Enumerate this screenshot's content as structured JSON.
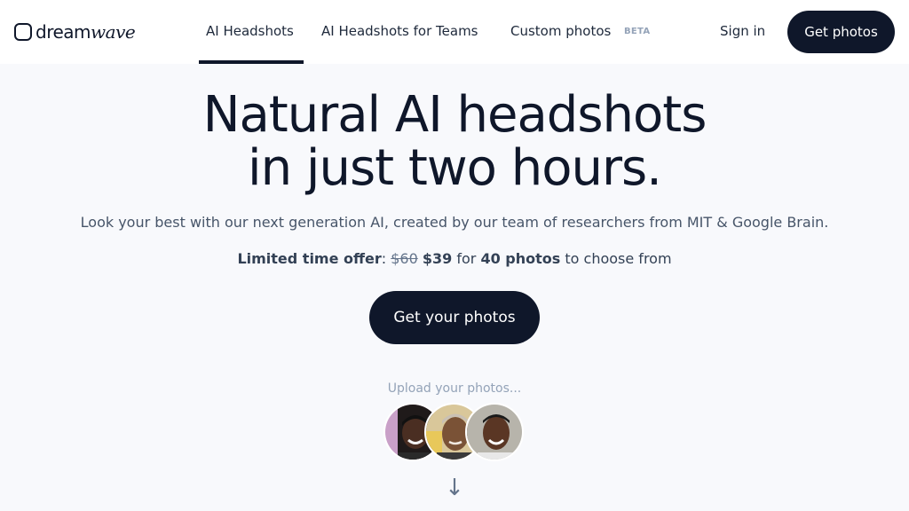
{
  "nav": {
    "logo_plain": "dream",
    "logo_italic": "wave",
    "links": [
      "AI Headshots",
      "AI Headshots for Teams",
      "Custom photos"
    ],
    "beta_badge": "BETA",
    "signin": "Sign in",
    "cta": "Get photos"
  },
  "hero": {
    "title_line1": "Natural AI headshots",
    "title_line2": "in just two hours.",
    "subtitle": "Look your best with our next generation AI, created by our team of researchers from MIT & Google Brain.",
    "offer_label": "Limited time offer",
    "offer_colon": ":",
    "old_price": "$60",
    "new_price": "$39",
    "for_text": "for",
    "photo_count": "40 photos",
    "choose_text": "to choose from",
    "cta": "Get your photos"
  },
  "upload": {
    "label": "Upload your photos...",
    "arrow": "↓"
  },
  "colors": {
    "primary": "#0f172a",
    "background": "#f8f9fc",
    "muted": "#94a3b8"
  }
}
